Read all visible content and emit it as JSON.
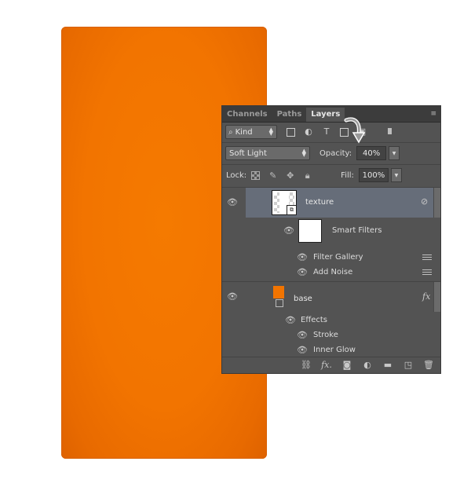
{
  "panel": {
    "tabs": [
      {
        "label": "Channels"
      },
      {
        "label": "Paths"
      },
      {
        "label": "Layers"
      }
    ],
    "filter": {
      "kind_label": "Kind"
    },
    "blend": {
      "mode": "Soft Light",
      "opacity_label": "Opacity:",
      "opacity_value": "40%"
    },
    "lock": {
      "label": "Lock:",
      "fill_label": "Fill:",
      "fill_value": "100%"
    },
    "layers": {
      "texture": {
        "name": "texture"
      },
      "smart_filters": {
        "label": "Smart Filters",
        "items": [
          "Filter Gallery",
          "Add Noise"
        ]
      },
      "base": {
        "name": "base",
        "fx": "fx",
        "effects_label": "Effects",
        "effects": [
          "Stroke",
          "Inner Glow"
        ]
      }
    }
  },
  "colors": {
    "canvas": "#f27400",
    "panel_bg": "#535353",
    "selected_row": "#666d79"
  }
}
